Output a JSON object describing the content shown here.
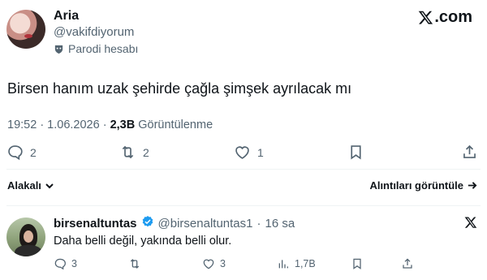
{
  "brand": {
    "site": ".com"
  },
  "tweet": {
    "author_name": "Aria",
    "handle": "@vakifdiyorum",
    "label": "Parodi hesabı",
    "text": "Birsen hanım uzak şehirde çağla şimşek ayrılacak mı",
    "time": "19:52 · 1.06.2026 ·",
    "views": "2,3B",
    "views_label": "Görüntülenme",
    "replies": "2",
    "reposts": "2",
    "likes": "1"
  },
  "replies_bar": {
    "sort_label": "Alakalı",
    "quotes_label": "Alıntıları görüntüle"
  },
  "reply": {
    "author_name": "birsenaltuntas",
    "handle": "@birsenaltuntas1",
    "dot": "·",
    "time": "16 sa",
    "text": "Daha belli değil, yakında belli olur.",
    "replies": "3",
    "likes": "3",
    "views": "1,7B"
  },
  "colors": {
    "text": "#0f1419",
    "secondary": "#536471",
    "verified": "#1d9bf0",
    "divider": "#eff3f4"
  },
  "icons": [
    "x-logo-icon",
    "parody-mask-icon",
    "reply-icon",
    "repost-icon",
    "like-icon",
    "bookmark-icon",
    "share-icon",
    "chevron-down-icon",
    "arrow-right-icon",
    "verified-badge-icon",
    "views-icon"
  ]
}
